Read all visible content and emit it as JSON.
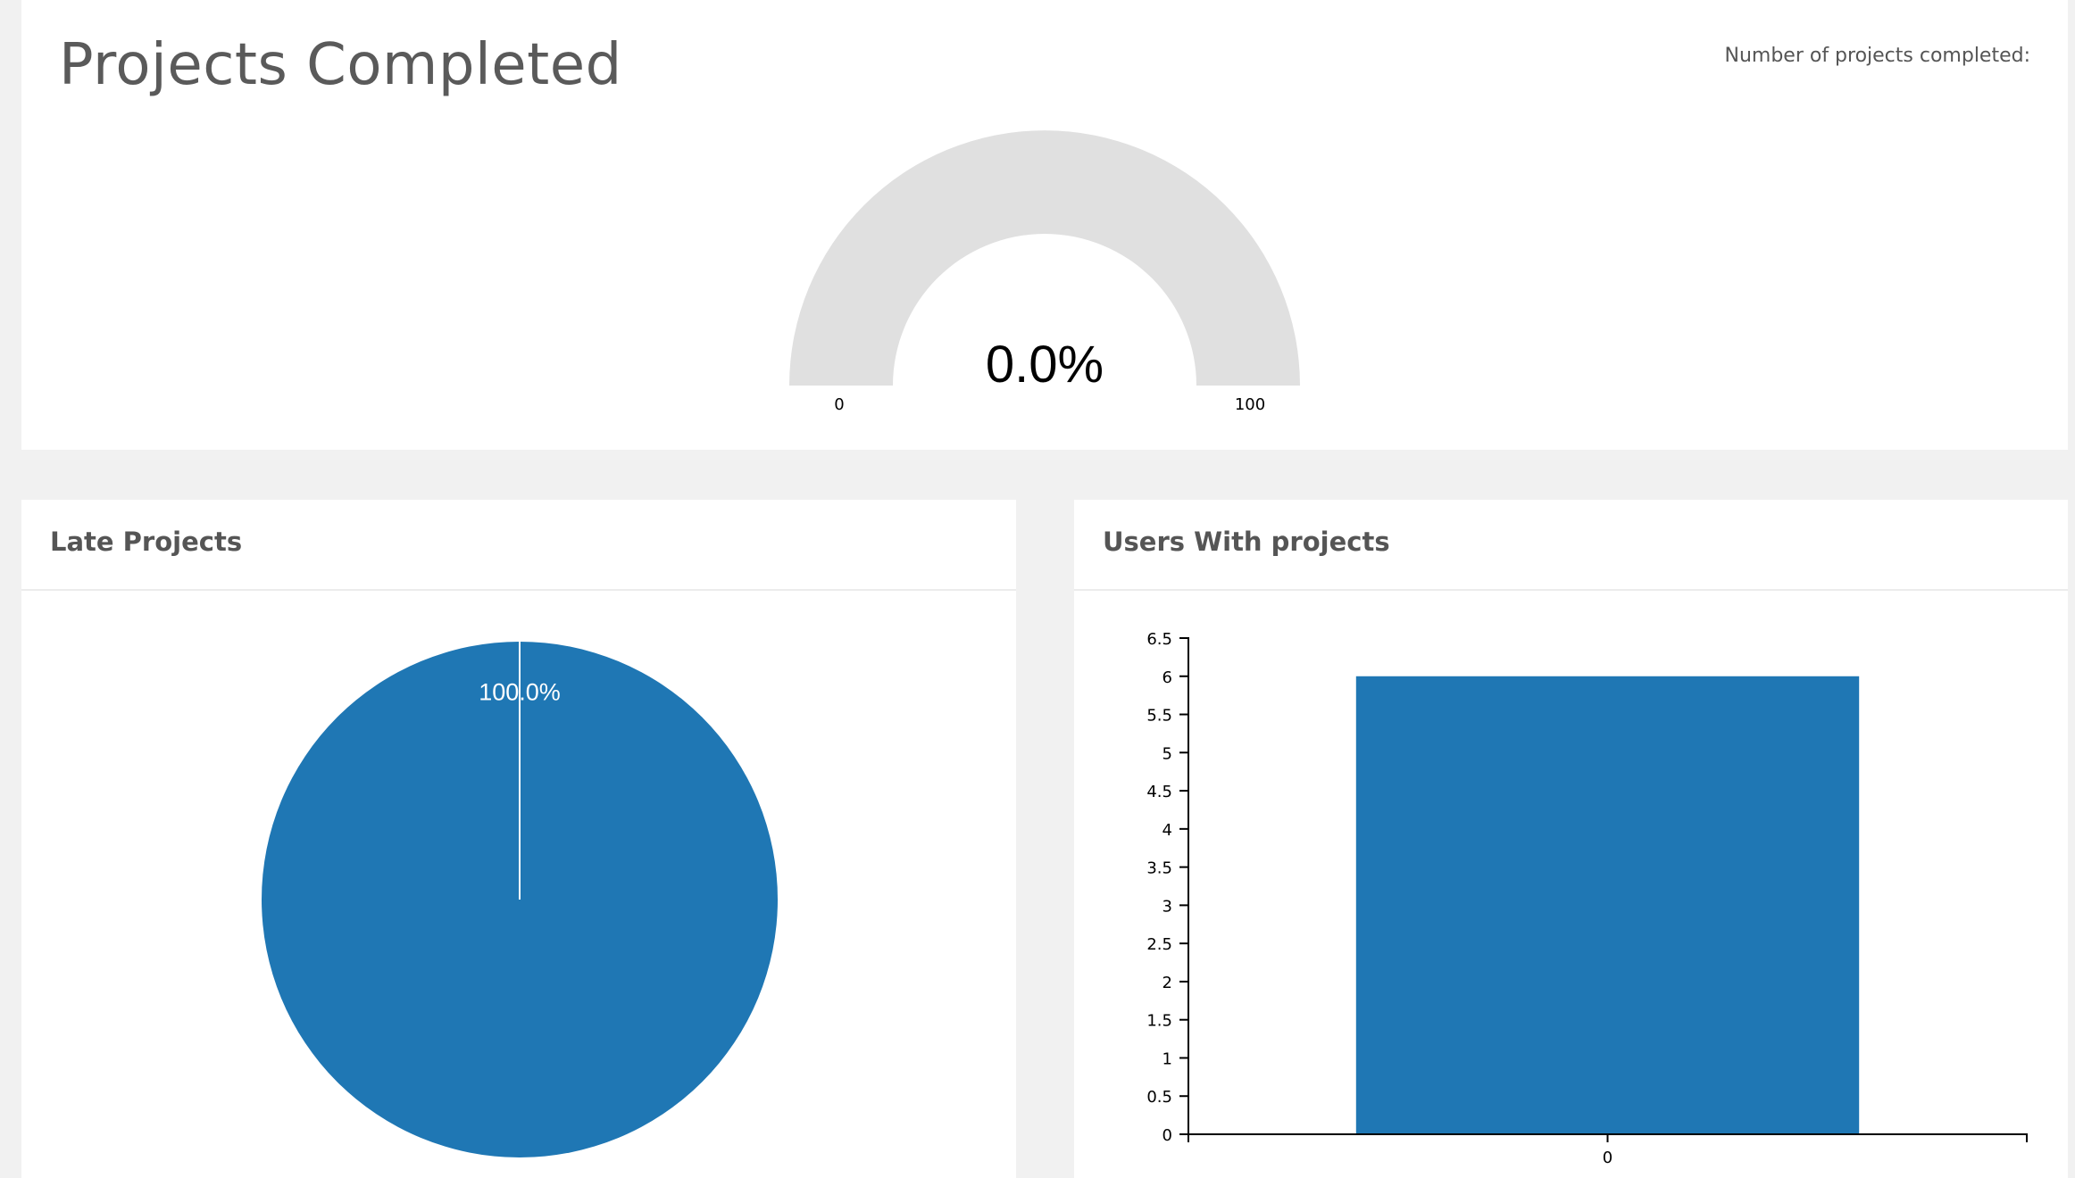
{
  "projects_completed": {
    "title": "Projects Completed",
    "side_label": "Number of projects completed:",
    "gauge": {
      "value_label": "0.0%",
      "value": 0,
      "min": 0,
      "max": 100,
      "min_label": "0",
      "max_label": "100",
      "track_color": "#e0e0e0"
    }
  },
  "late_projects": {
    "title": "Late Projects",
    "chart_data": {
      "type": "pie",
      "slices": [
        {
          "value": 100.0,
          "label": "100.0%",
          "color": "#1f77b4"
        }
      ]
    }
  },
  "users_with_projects": {
    "title": "Users With projects",
    "chart_data": {
      "type": "bar",
      "categories": [
        "0"
      ],
      "values": [
        6
      ],
      "ylim": [
        0,
        6.5
      ],
      "yticks": [
        "0",
        "0.5",
        "1",
        "1.5",
        "2",
        "2.5",
        "3",
        "3.5",
        "4",
        "4.5",
        "5",
        "5.5",
        "6",
        "6.5"
      ],
      "color": "#1f77b4"
    }
  }
}
